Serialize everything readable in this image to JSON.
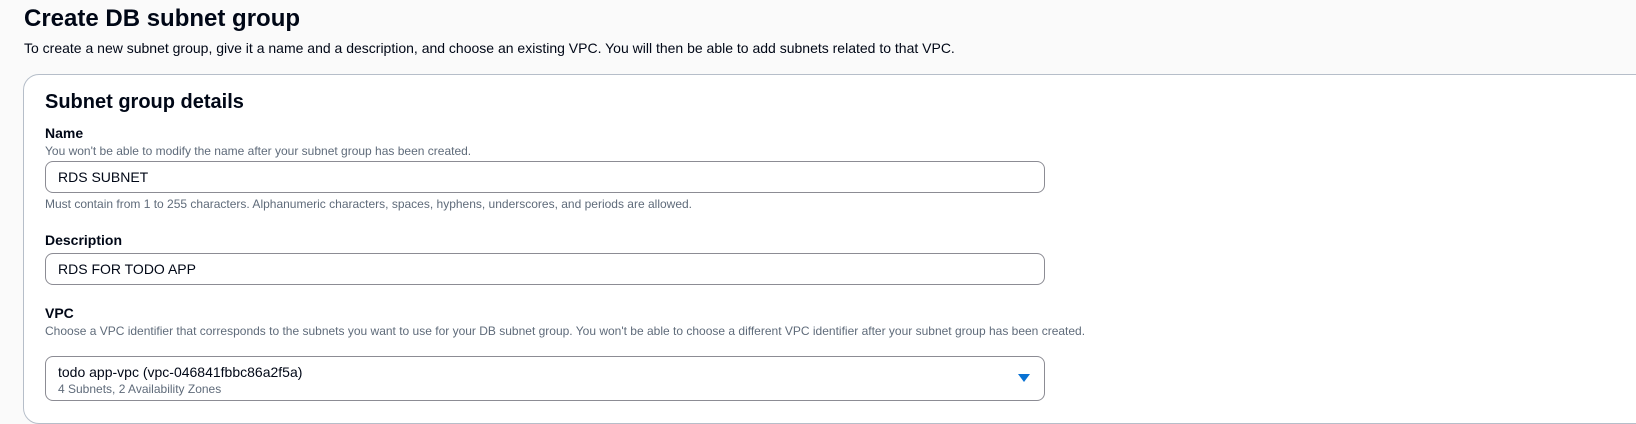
{
  "page": {
    "title": "Create DB subnet group",
    "subtitle": "To create a new subnet group, give it a name and a description, and choose an existing VPC. You will then be able to add subnets related to that VPC."
  },
  "details": {
    "heading": "Subnet group details",
    "name": {
      "label": "Name",
      "description": "You won't be able to modify the name after your subnet group has been created.",
      "value": "RDS SUBNET",
      "constraint": "Must contain from 1 to 255 characters. Alphanumeric characters, spaces, hyphens, underscores, and periods are allowed."
    },
    "description": {
      "label": "Description",
      "value": "RDS FOR TODO APP"
    },
    "vpc": {
      "label": "VPC",
      "description": "Choose a VPC identifier that corresponds to the subnets you want to use for your DB subnet group. You won't be able to choose a different VPC identifier after your subnet group has been created.",
      "selected": "todo app-vpc (vpc-046841fbbc86a2f5a)",
      "selected_detail": "4 Subnets, 2 Availability Zones",
      "caret_icon": "caret-down-icon"
    }
  },
  "colors": {
    "accent": "#0972d3",
    "background": "#fafafa",
    "panel": "#ffffff",
    "border": "#b6bec9"
  }
}
